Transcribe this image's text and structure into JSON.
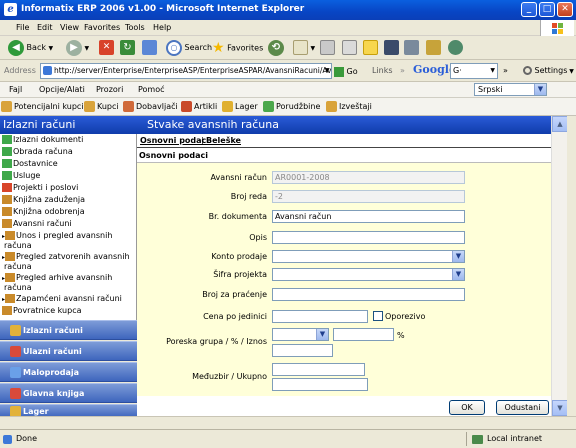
{
  "window": {
    "title": "Informatix ERP 2006 v1.00 - Microsoft Internet Explorer"
  },
  "ie_menu": [
    "File",
    "Edit",
    "View",
    "Favorites",
    "Tools",
    "Help"
  ],
  "toolbar": {
    "back": "Back",
    "search": "Search",
    "favorites": "Favorites"
  },
  "address": {
    "label": "Address",
    "url": "http://server/Enterprise/EnterpriseASP/EnterpriseASPAR/AvansniRacuni/Avansni",
    "go": "Go",
    "links": "Links",
    "google": "Google",
    "google_sel": "G·",
    "settings": "Settings"
  },
  "app_menu": [
    "Fajl",
    "Opcije/Alati",
    "Prozori",
    "Pomoć"
  ],
  "language": "Srpski",
  "nav": [
    "Potencijalni kupci",
    "Kupci",
    "Dobavljači",
    "Artikli",
    "Lager",
    "Porudžbine",
    "Izveštaji"
  ],
  "left_panel": {
    "title": "Izlazni računi",
    "tree": [
      "Izlazni dokumenti",
      "Obrada računa",
      "Dostavnice",
      "Usluge",
      "Projekti i poslovi",
      "Knjižna zaduženja",
      "Knjižna odobrenja",
      "Avansni računi",
      "Unos i pregled avansnih",
      "računa",
      "Pregled zatvorenih avansnih",
      "računa",
      "Pregled arhive avansnih",
      "računa",
      "Zapamćeni avansni računi",
      "Povratnice kupca"
    ],
    "sections": [
      "Izlazni računi",
      "Ulazni računi",
      "Maloprodaja",
      "Glavna knjiga",
      "Lager"
    ]
  },
  "main": {
    "title": "Stvake avansnih računa",
    "tab_main": "Osnovni podaci",
    "tab_sep": "|",
    "tab_notes": "Beleške",
    "section": "Osnovni podaci",
    "labels": {
      "account": "Avansni račun",
      "line": "Broj reda",
      "doc": "Br. dokumenta",
      "desc": "Opis",
      "konto": "Konto prodaje",
      "project": "Šifra projekta",
      "tracking": "Broj za praćenje",
      "price": "Cena po jedinici",
      "taxable": "Oporezivo",
      "tax": "Poreska grupa / % / Iznos",
      "percent": "%",
      "total": "Međuzbir / Ukupno"
    },
    "values": {
      "account": "AR0001-2008",
      "line": "-2",
      "doc": "Avansni račun"
    },
    "ok": "OK",
    "cancel": "Odustani"
  },
  "status": {
    "text": "Done",
    "zone": "Local intranet"
  },
  "colors": {
    "header_blue": "#1A47C0",
    "form_bg": "#FFFFD9",
    "accordion": "#4F74C8"
  }
}
